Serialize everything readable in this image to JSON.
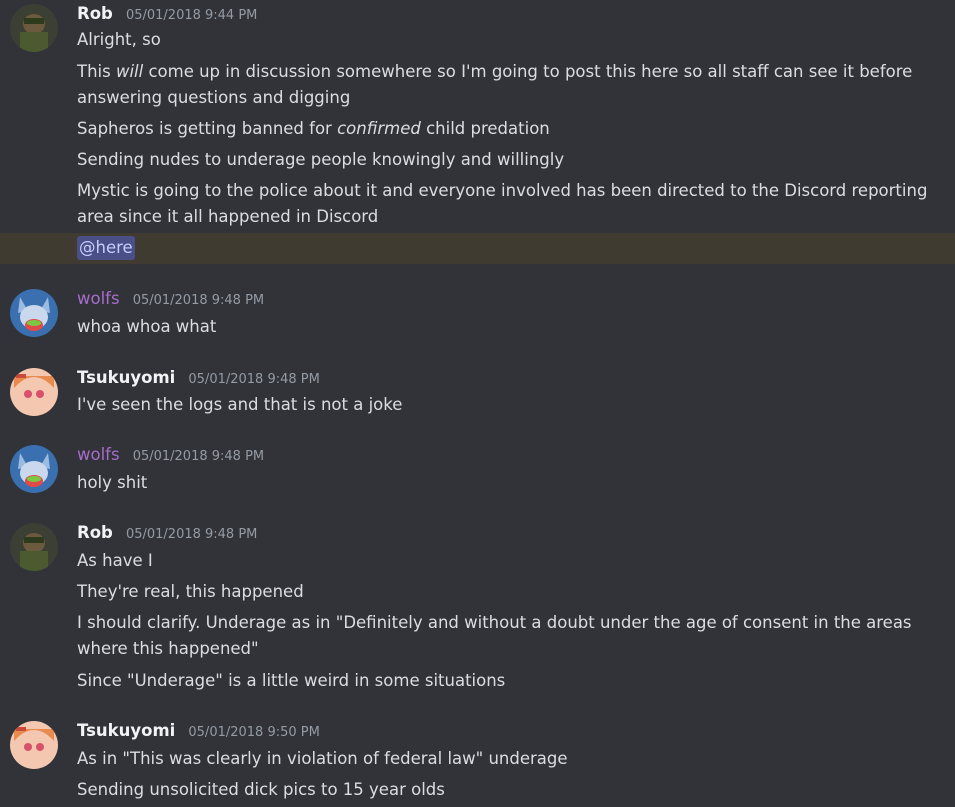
{
  "users": {
    "rob": {
      "name": "Rob",
      "color": "#f2f3f5"
    },
    "wolfs": {
      "name": "wolfs",
      "color": "#a66dc9"
    },
    "tsukuyomi": {
      "name": "Tsukuyomi",
      "color": "#f2f3f5"
    }
  },
  "messages": [
    {
      "author": "Rob",
      "timestamp": "05/01/2018 9:44 PM",
      "lines": [
        "Alright, so",
        {
          "pre": "This ",
          "em": "will",
          "post": " come up in discussion somewhere so I'm going to post this here so all staff can see it before answering questions and digging"
        },
        {
          "pre": "Sapheros is getting banned for ",
          "em": "confirmed",
          "post": " child predation"
        },
        "Sending nudes to underage people knowingly and willingly",
        "Mystic is going to the police about it and everyone involved has been directed to the Discord reporting area since it all happened in Discord"
      ],
      "mention": "@here"
    },
    {
      "author": "wolfs",
      "timestamp": "05/01/2018 9:48 PM",
      "lines": [
        "whoa whoa what"
      ]
    },
    {
      "author": "Tsukuyomi",
      "timestamp": "05/01/2018 9:48 PM",
      "lines": [
        "I've seen the logs and that is not a joke"
      ]
    },
    {
      "author": "wolfs",
      "timestamp": "05/01/2018 9:48 PM",
      "lines": [
        "holy shit"
      ]
    },
    {
      "author": "Rob",
      "timestamp": "05/01/2018 9:48 PM",
      "lines": [
        "As have I",
        "They're real, this happened",
        "I should clarify.  Underage as in \"Definitely and without a doubt under the age of consent in the areas where this happened\"",
        "Since \"Underage\" is a little weird in some situations"
      ]
    },
    {
      "author": "Tsukuyomi",
      "timestamp": "05/01/2018 9:50 PM",
      "lines": [
        "As in \"This was clearly in violation of federal law\" underage",
        "Sending unsolicited dick pics to 15 year olds"
      ]
    }
  ],
  "avatar_icons": {
    "rob": "rob-avatar-icon",
    "wolfs": "wolf-avatar-icon",
    "tsukuyomi": "anime-girl-avatar-icon"
  },
  "colors": {
    "background": "#323339",
    "mention_highlight": "#3f3b31",
    "mention_pill": "#4a4f88",
    "timestamp": "#949ba4"
  }
}
